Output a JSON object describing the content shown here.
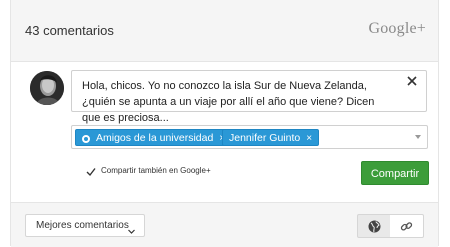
{
  "header": {
    "comment_count": "43 comentarios",
    "brand": "Google+"
  },
  "composer": {
    "text": "Hola, chicos. Yo no conozco la isla Sur de Nueva Zelanda, ¿quién se apunta a un viaje por allí el año que viene? Dicen que es preciosa...",
    "recipients": [
      {
        "label": "Amigos de la universidad",
        "type": "circle"
      },
      {
        "label": "Jennifer Guinto",
        "type": "person"
      }
    ],
    "also_share_label": "Compartir también en Google+",
    "also_share_checked": true,
    "share_button": "Compartir"
  },
  "footer": {
    "sort_label": "Mejores comentarios"
  },
  "colors": {
    "chip": "#2a98d6",
    "share_button": "#3c9d3a"
  }
}
